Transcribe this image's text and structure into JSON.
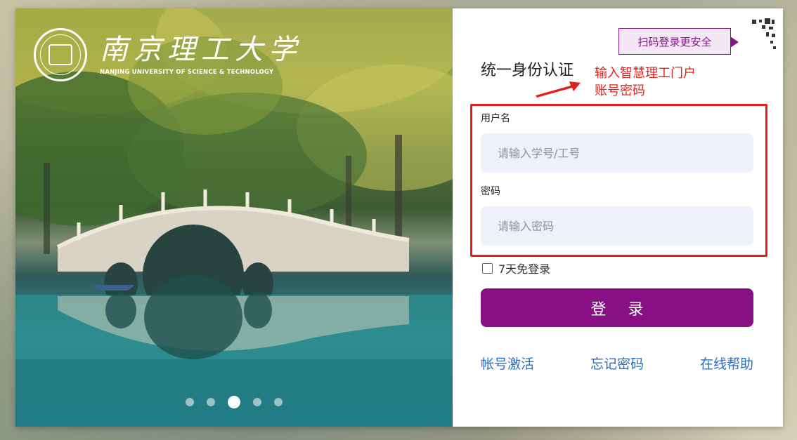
{
  "branding": {
    "name_cn": "南京理工大学",
    "name_en": "NANJING UNIVERSITY OF SCIENCE & TECHNOLOGY"
  },
  "carousel": {
    "slides": 5,
    "active_index": 2
  },
  "login": {
    "scan_tip": "扫码登录更安全",
    "title": "统一身份认证",
    "annotation_line1": "输入智慧理工门户",
    "annotation_line2": "账号密码",
    "username_label": "用户名",
    "username_placeholder": "请输入学号/工号",
    "password_label": "密码",
    "password_placeholder": "请输入密码",
    "remember_label": "7天免登录",
    "submit_label": "登 录"
  },
  "links": {
    "activate": "帐号激活",
    "forgot": "忘记密码",
    "help": "在线帮助"
  },
  "colors": {
    "brand": "#880f84",
    "link": "#2a6fc7",
    "annotation": "#e0201a",
    "input_bg": "#eef1f8"
  },
  "icons": [
    "university-seal-icon",
    "qr-code-corner-icon",
    "red-arrow-icon",
    "checkbox-icon"
  ]
}
